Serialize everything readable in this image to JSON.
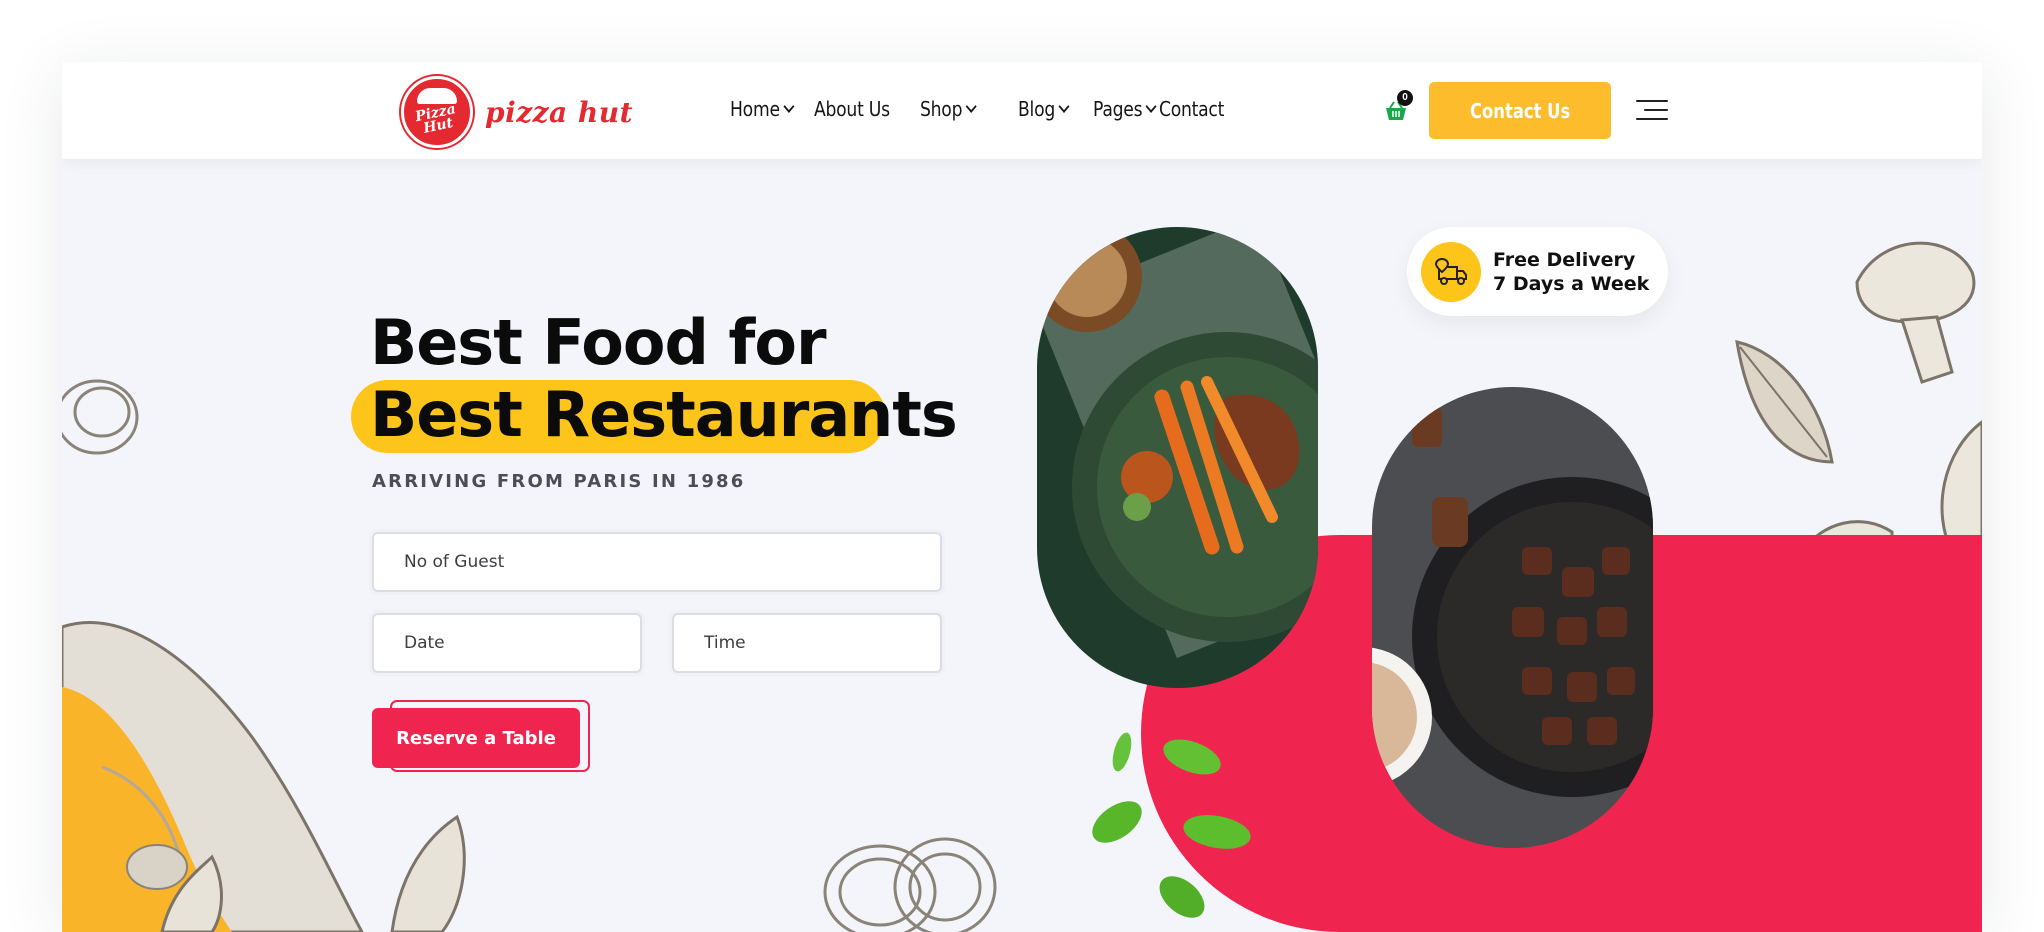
{
  "brand": {
    "badge_text": "Pizza Hut",
    "name": "pizza hut",
    "color": "#e52930"
  },
  "nav": [
    {
      "label": "Home",
      "dropdown": true
    },
    {
      "label": "About Us",
      "dropdown": false
    },
    {
      "label": "Shop",
      "dropdown": true
    },
    {
      "label": "Blog",
      "dropdown": true
    },
    {
      "label": "Pages",
      "dropdown": true
    },
    {
      "label": "Contact",
      "dropdown": false
    }
  ],
  "cart": {
    "count": "0",
    "icon": "basket-icon"
  },
  "header": {
    "contact_label": "Contact Us",
    "menu_icon": "menu-icon"
  },
  "hero": {
    "line1": "Best Food for",
    "line2": "Best Restaurants",
    "subtitle": "ARRIVING FROM PARIS IN 1986"
  },
  "form": {
    "guests_placeholder": "No of Guest",
    "date_placeholder": "Date",
    "time_placeholder": "Time",
    "reserve_label": "Reserve a Table"
  },
  "delivery": {
    "text": "Free Delivery 7 Days a Week",
    "icon": "delivery-truck-icon"
  },
  "colors": {
    "accent_yellow": "#fdc51a",
    "accent_red": "#ef2550",
    "button_yellow": "#fdbc2c"
  }
}
